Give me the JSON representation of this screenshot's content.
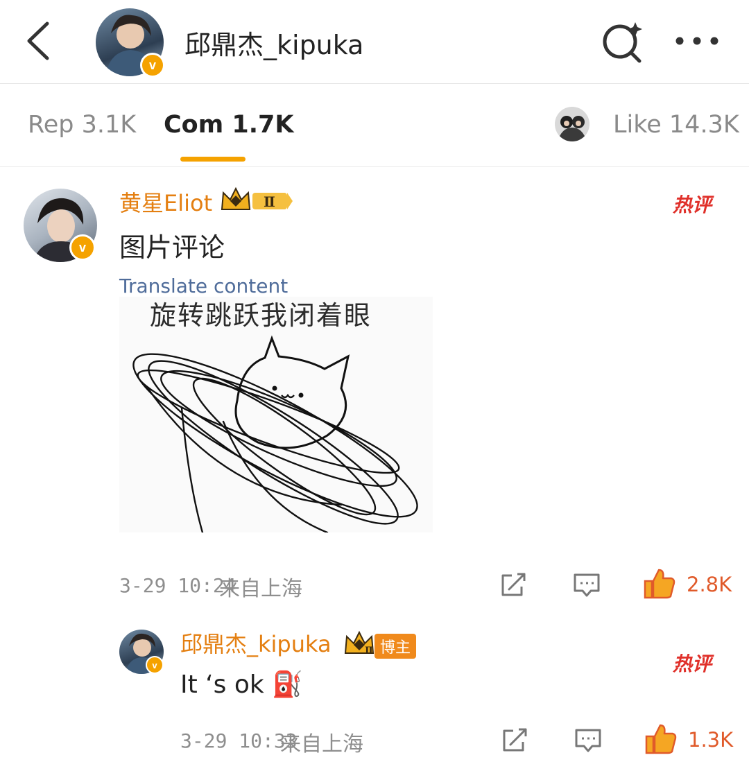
{
  "header": {
    "title": "邱鼎杰_kipuka",
    "avatar_badge": "v",
    "icons": [
      "back-icon",
      "search-icon",
      "more-icon"
    ]
  },
  "tabs": [
    {
      "label": "Rep 3.1K"
    },
    {
      "label": "Com 1.7K",
      "active": true
    },
    {
      "label": "Like 14.3K"
    }
  ],
  "comment": {
    "username": "黄星Eliot",
    "level_badge": "Ⅱ",
    "hot_label": "热评",
    "text": "图片评论",
    "translate_label": "Translate content",
    "image_caption": "旋转跳跃我闭着眼",
    "time": "3-29 10:24",
    "location": "来自上海",
    "likes": "2.8K",
    "avatar_badge": "v"
  },
  "reply": {
    "username": "邱鼎杰_kipuka",
    "level_badge": "Ⅱ",
    "host_tag": "博主",
    "hot_label": "热评",
    "text": "It ‘s ok ⛽",
    "time": "3-29 10:33",
    "location": "来自上海",
    "likes": "1.3K",
    "avatar_badge": "v"
  },
  "colors": {
    "accent": "#f5a200",
    "username": "#e47f11",
    "like": "#e05a2a",
    "hot": "#e0302a",
    "translate": "#4f6c9a"
  }
}
